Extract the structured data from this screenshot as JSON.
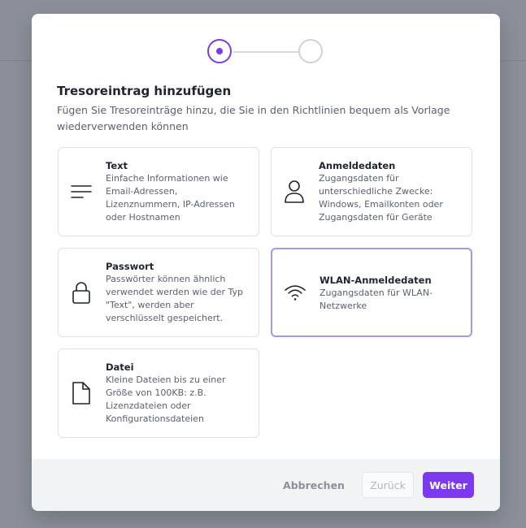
{
  "dialog": {
    "title": "Tresoreintrag hinzufügen",
    "subtitle": "Fügen Sie Tresoreinträge hinzu, die Sie in den Richtlinien bequem als Vorlage wiederverwenden können"
  },
  "stepper": {
    "current_step": 1,
    "total_steps": 2
  },
  "cards": [
    {
      "title": "Text",
      "description": "Einfache Informationen wie Email-Adressen, Lizenznummern, IP-Adressen oder Hostnamen",
      "icon": "text-lines-icon"
    },
    {
      "title": "Anmeldedaten",
      "description": "Zugangsdaten für unterschiedliche Zwecke: Windows, Emailkonten oder Zugangsdaten für Geräte",
      "icon": "user-icon"
    },
    {
      "title": "Passwort",
      "description": "Passwörter können ähnlich verwendet werden wie der Typ \"Text\", werden aber verschlüsselt gespeichert.",
      "icon": "lock-icon"
    },
    {
      "title": "WLAN-Anmeldedaten",
      "description": "Zugangsdaten für WLAN-Netzwerke",
      "icon": "wifi-icon",
      "selected": true
    },
    {
      "title": "Datei",
      "description": "Kleine Dateien bis zu einer Größe von 100KB: z.B. Lizenzdateien oder Konfigurationsdateien",
      "icon": "file-icon"
    }
  ],
  "footer": {
    "cancel_label": "Abbrechen",
    "back_label": "Zurück",
    "next_label": "Weiter"
  },
  "colors": {
    "accent": "#7c3aed",
    "selected_border": "#a897e9"
  }
}
